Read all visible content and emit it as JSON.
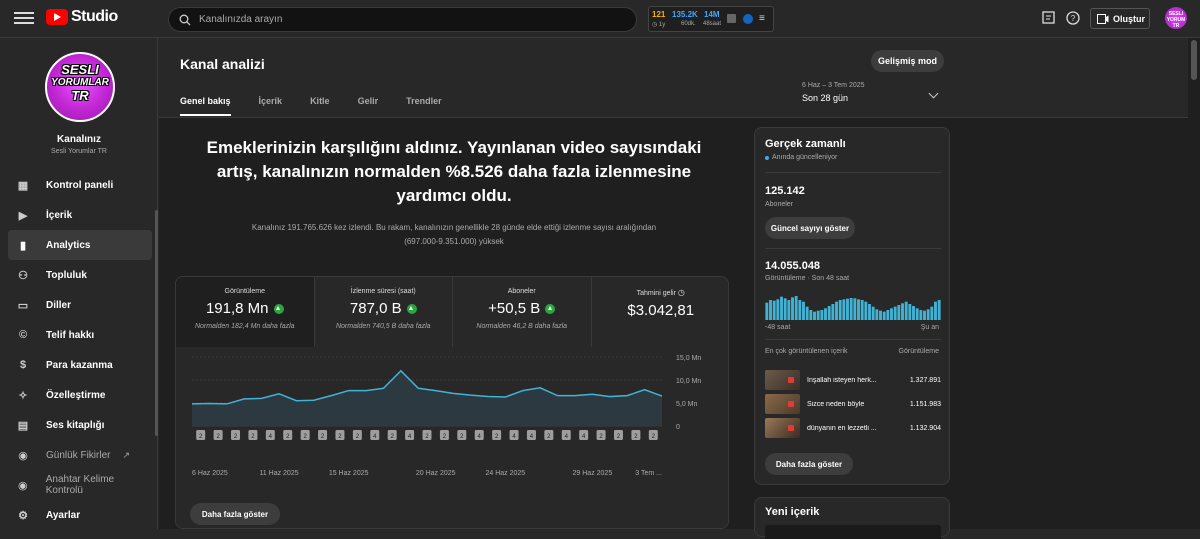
{
  "topbar": {
    "logo_text": "Studio",
    "search_placeholder": "Kanalınızda arayın",
    "stats": [
      {
        "value": "121",
        "sub": "1y",
        "color": "#f5b400"
      },
      {
        "value": "135.2K",
        "sub": "60dk.",
        "color": "#3ea6ff"
      },
      {
        "value": "14M",
        "sub": "48saat",
        "color": "#3ea6ff"
      }
    ],
    "create_label": "Oluştur",
    "avatar_text": "SESLI YORUMLAR TR"
  },
  "sidebar": {
    "channel_avatar_lines": [
      "SESLI",
      "YORUMLAR",
      "TR"
    ],
    "channel_label": "Kanalınız",
    "channel_name": "Sesli Yorumlar TR",
    "items": [
      {
        "label": "Kontrol paneli",
        "icon": "dashboard-icon"
      },
      {
        "label": "İçerik",
        "icon": "content-icon"
      },
      {
        "label": "Analytics",
        "icon": "analytics-icon"
      },
      {
        "label": "Topluluk",
        "icon": "community-icon"
      },
      {
        "label": "Diller",
        "icon": "subtitles-icon"
      },
      {
        "label": "Telif hakkı",
        "icon": "copyright-icon"
      },
      {
        "label": "Para kazanma",
        "icon": "dollar-icon"
      },
      {
        "label": "Özelleştirme",
        "icon": "magic-wand-icon"
      },
      {
        "label": "Ses kitaplığı",
        "icon": "audio-library-icon"
      },
      {
        "label": "Günlük Fikirler",
        "icon": "ideas-icon"
      },
      {
        "label": "Anahtar Kelime Kontrolü",
        "icon": "keyword-icon"
      },
      {
        "label": "Ayarlar",
        "icon": "settings-icon"
      }
    ]
  },
  "header": {
    "title": "Kanal analizi",
    "advanced_mode": "Gelişmiş mod",
    "tabs": [
      "Genel bakış",
      "İçerik",
      "Kitle",
      "Gelir",
      "Trendler"
    ],
    "date_small": "6 Haz – 3 Tem 2025",
    "date_big": "Son 28 gün"
  },
  "overview": {
    "headline": "Emeklerinizin karşılığını aldınız. Yayınlanan video sayısındaki artış, kanalınızın normalden %8.526 daha fazla izlenmesine yardımcı oldu.",
    "subtext": "Kanalınız 191.765.626 kez izlendi. Bu rakam, kanalınızın genellikle 28 günde elde ettiği izlenme sayısı aralığından (697.000-9.351.000) yüksek",
    "metrics": [
      {
        "label": "Görüntüleme",
        "value": "191,8 Mn",
        "sub": "Normalden 182,4 Mn daha fazla",
        "up": true
      },
      {
        "label": "İzlenme süresi (saat)",
        "value": "787,0 B",
        "sub": "Normalden 740,5 B daha fazla",
        "up": true
      },
      {
        "label": "Aboneler",
        "value": "+50,5 B",
        "sub": "Normalden 46,2 B daha fazla",
        "up": true
      },
      {
        "label": "Tahmini gelir",
        "value": "$3.042,81",
        "sub": "",
        "up": false
      }
    ],
    "more_button": "Daha fazla göster"
  },
  "chart_data": {
    "type": "area",
    "x": [
      "6 Haz 2025",
      "7 Haz",
      "8 Haz",
      "9 Haz",
      "10 Haz",
      "11 Haz",
      "12 Haz",
      "13 Haz",
      "14 Haz",
      "15 Haz 2025",
      "16 Haz",
      "17 Haz",
      "18 Haz",
      "19 Haz",
      "20 Haz 2025",
      "21 Haz",
      "22 Haz",
      "23 Haz",
      "24 Haz 2025",
      "25 Haz",
      "26 Haz",
      "27 Haz",
      "28 Haz",
      "29 Haz 2025",
      "30 Haz",
      "1 Tem",
      "2 Tem",
      "3 Tem"
    ],
    "values": [
      4.8,
      4.9,
      4.8,
      5.9,
      6.0,
      7.0,
      5.5,
      5.6,
      6.6,
      7.7,
      7.7,
      8.2,
      12.0,
      8.2,
      7.7,
      7.1,
      6.7,
      6.4,
      6.3,
      7.7,
      8.3,
      6.6,
      6.6,
      6.9,
      6.4,
      6.6,
      7.9,
      6.5
    ],
    "x_tick_labels": [
      "6 Haz 2025",
      "11 Haz 2025",
      "15 Haz 2025",
      "20 Haz 2025",
      "24 Haz 2025",
      "29 Haz 2025",
      "3 Tem ..."
    ],
    "y_ticks": [
      "15,0 Mn",
      "10,0 Mn",
      "5,0 Mn",
      "0"
    ],
    "ylim": [
      0,
      15
    ],
    "video_markers": [
      "2",
      "2",
      "2",
      "2",
      "4",
      "2",
      "2",
      "2",
      "2",
      "2",
      "4",
      "2",
      "4",
      "2",
      "2",
      "2",
      "4",
      "2",
      "4",
      "4",
      "2",
      "4",
      "4",
      "2",
      "2",
      "2",
      "2",
      "2"
    ],
    "grid": true,
    "line_color": "#41b4d6"
  },
  "realtime": {
    "title": "Gerçek zamanlı",
    "subtitle": "Anında güncelleniyor",
    "subs_value": "125.142",
    "subs_label": "Aboneler",
    "subs_button": "Güncel sayıyı göster",
    "views_value": "14.055.048",
    "views_label": "Görüntüleme · Son 48 saat",
    "bar_start": "-48 saat",
    "bar_end": "Şu an",
    "bar_values": [
      52,
      60,
      58,
      62,
      70,
      65,
      60,
      68,
      72,
      60,
      55,
      40,
      30,
      25,
      28,
      30,
      35,
      42,
      48,
      55,
      60,
      62,
      64,
      66,
      65,
      62,
      60,
      55,
      48,
      40,
      32,
      28,
      25,
      30,
      35,
      40,
      45,
      50,
      55,
      48,
      42,
      35,
      30,
      28,
      32,
      40,
      55,
      60
    ],
    "top_header_left": "En çok görüntülenen içerik",
    "top_header_right": "Görüntüleme",
    "top_items": [
      {
        "title": "İnşallah isteyen herk...",
        "value": "1.327.891"
      },
      {
        "title": "Sizce neden böyle",
        "value": "1.151.983"
      },
      {
        "title": "dünyanın en lezzetli ...",
        "value": "1.132.904"
      }
    ],
    "more_button": "Daha fazla göster"
  },
  "new_content": {
    "title": "Yeni içerik"
  }
}
